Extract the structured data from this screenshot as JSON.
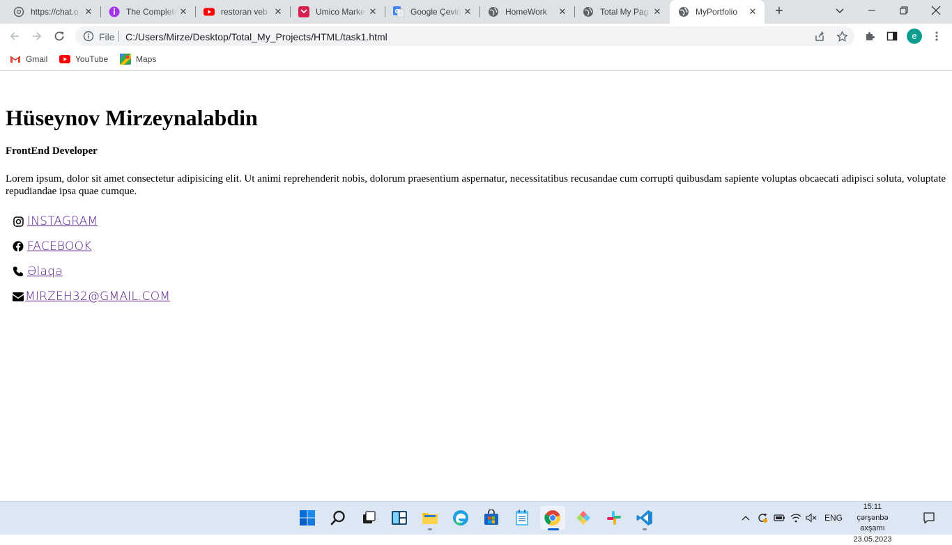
{
  "browser": {
    "tabs": [
      {
        "title": "https://chat.o",
        "icon": "openai-icon"
      },
      {
        "title": "The Complete",
        "icon": "udemy-icon"
      },
      {
        "title": "restoran veb",
        "icon": "youtube-icon"
      },
      {
        "title": "Umico Marke",
        "icon": "umico-icon"
      },
      {
        "title": "Google Çeviri",
        "icon": "google-translate-icon"
      },
      {
        "title": "HomeWork",
        "icon": "globe-icon"
      },
      {
        "title": "Total My Pag",
        "icon": "globe-icon"
      },
      {
        "title": "MyPortfolio",
        "icon": "globe-icon",
        "active": true
      }
    ],
    "omnibox": {
      "scheme_label": "File",
      "url": "C:/Users/Mirze/Desktop/Total_My_Projects/HTML/task1.html"
    },
    "profile_initial": "e",
    "bookmarks": [
      {
        "label": "Gmail",
        "icon": "gmail-icon"
      },
      {
        "label": "YouTube",
        "icon": "youtube-icon"
      },
      {
        "label": "Maps",
        "icon": "maps-icon"
      }
    ]
  },
  "page": {
    "name": "Hüseynov Mirzeynalabdin",
    "role": "FrontEnd Developer",
    "bio": "Lorem ipsum, dolor sit amet consectetur adipisicing elit. Ut animi reprehenderit nobis, dolorum praesentium aspernatur, necessitatibus recusandae cum corrupti quibusdam sapiente voluptas obcaecati adipisci soluta, voluptate repudiandae ipsa quae cumque.",
    "links": [
      {
        "label": "Instagram",
        "icon": "instagram-icon"
      },
      {
        "label": "Facebook",
        "icon": "facebook-icon"
      },
      {
        "label": "Əlaqə",
        "icon": "phone-icon"
      },
      {
        "label": "mirzeh32@gmail.com",
        "icon": "envelope-icon"
      }
    ]
  },
  "taskbar": {
    "language": "ENG",
    "time": "15:11",
    "day": "çərşənbə axşamı",
    "date": "23.05.2023"
  },
  "colors": {
    "tabstrip": "#dee1e6",
    "link_visited": "#551a8b",
    "taskbar": "#dde6f3",
    "profile_avatar": "#0f9d8f"
  }
}
